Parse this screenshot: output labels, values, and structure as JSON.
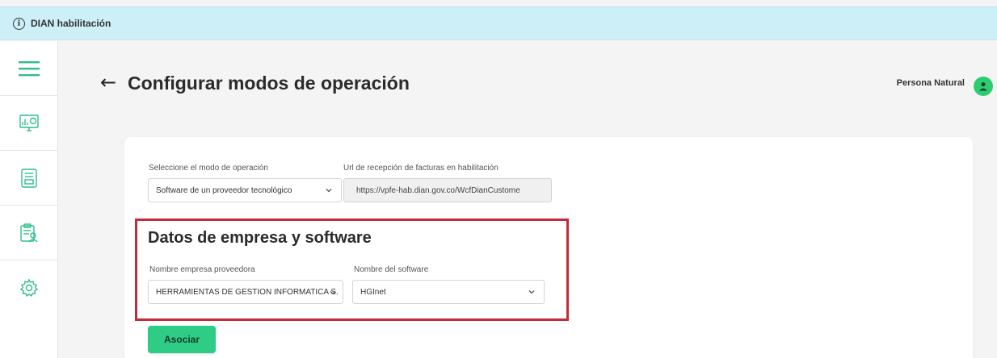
{
  "banner": {
    "title": "DIAN habilitación",
    "icon": "info-icon"
  },
  "header": {
    "back_icon": "arrow-left-icon",
    "title": "Configurar modos de operación",
    "user_label": "Persona Natural",
    "avatar_icon": "person-icon"
  },
  "sidebar": {
    "items": [
      {
        "icon": "menu-icon"
      },
      {
        "icon": "dashboard-monitor-icon"
      },
      {
        "icon": "document-list-icon"
      },
      {
        "icon": "clipboard-user-icon"
      },
      {
        "icon": "gear-icon"
      }
    ]
  },
  "form": {
    "mode_label": "Seleccione el modo de operación",
    "mode_value": "Software de un proveedor tecnológico",
    "url_label": "Url de recepción de facturas en habilitación",
    "url_value": "https://vpfe-hab.dian.gov.co/WcfDianCustome",
    "section_title": "Datos de empresa y software",
    "provider_label": "Nombre empresa proveedora",
    "provider_value": "HERRAMIENTAS DE GESTION INFORMATICA S.",
    "software_label": "Nombre del software",
    "software_value": "HGInet",
    "submit_label": "Asociar"
  },
  "colors": {
    "accent_green": "#2ecc85",
    "highlight_red": "#c62a3a",
    "banner_bg": "#cdeff7",
    "sidebar_icon": "#2fbf8a"
  }
}
